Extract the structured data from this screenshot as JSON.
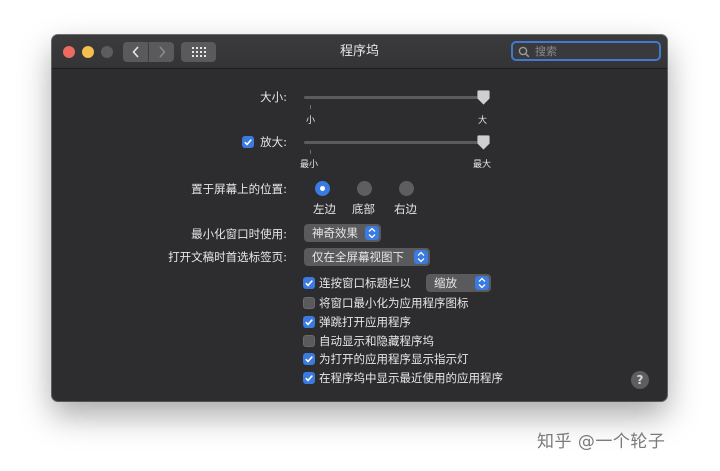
{
  "window": {
    "title": "程序坞",
    "search": {
      "placeholder": "搜索"
    }
  },
  "size": {
    "label": "大小:",
    "min_label": "小",
    "max_label": "大",
    "value_fraction": 1.0
  },
  "magnification": {
    "label": "放大:",
    "checked": true,
    "min_label": "最小",
    "max_label": "最大",
    "value_fraction": 1.0
  },
  "position": {
    "label": "置于屏幕上的位置:",
    "options": [
      {
        "label": "左边",
        "selected": true
      },
      {
        "label": "底部",
        "selected": false
      },
      {
        "label": "右边",
        "selected": false
      }
    ]
  },
  "minimize_effect": {
    "label": "最小化窗口时使用:",
    "value": "神奇效果"
  },
  "prefer_tabs": {
    "label": "打开文稿时首选标签页:",
    "value": "仅在全屏幕视图下"
  },
  "checkboxes": {
    "double_click": {
      "label": "连按窗口标题栏以",
      "checked": true,
      "popup_value": "缩放"
    },
    "minimize_into_icon": {
      "label": "将窗口最小化为应用程序图标",
      "checked": false
    },
    "animate_opening": {
      "label": "弹跳打开应用程序",
      "checked": true
    },
    "autohide": {
      "label": "自动显示和隐藏程序坞",
      "checked": false
    },
    "show_indicators": {
      "label": "为打开的应用程序显示指示灯",
      "checked": true
    },
    "show_recent": {
      "label": "在程序坞中显示最近使用的应用程序",
      "checked": true
    }
  },
  "help": {
    "label": "?"
  },
  "watermark": {
    "text": "知乎 @一个轮子"
  },
  "colors": {
    "accent": "#3b7ae0",
    "window_bg": "#2d2d2f"
  }
}
